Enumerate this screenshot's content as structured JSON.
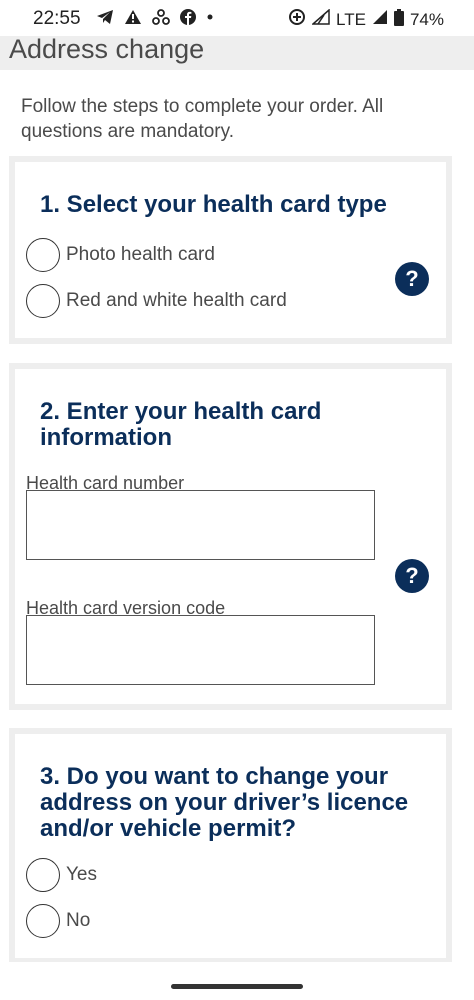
{
  "status_bar": {
    "time": "22:55",
    "network": "LTE",
    "battery": "74%",
    "icons_left": [
      "telegram-icon",
      "warning-icon",
      "recycle-icon",
      "facebook-icon",
      "dot-icon"
    ],
    "icons_right": [
      "data-saver-icon",
      "signal-icon",
      "battery-icon"
    ]
  },
  "header": {
    "title": "Address change"
  },
  "intro_text": "Follow the steps to complete your order. All questions are mandatory.",
  "section1": {
    "title": "1. Select your health card type",
    "options": [
      "Photo health card",
      "Red and white health card"
    ],
    "help_label": "?"
  },
  "section2": {
    "title": "2. Enter your health card information",
    "field1_label": "Health card number",
    "field1_value": "",
    "field2_label": "Health card version code",
    "field2_value": "",
    "help_label": "?"
  },
  "section3": {
    "title": "3. Do you want to change your address on your driver’s licence and/or vehicle permit?",
    "options": [
      "Yes",
      "No"
    ]
  },
  "colors": {
    "accent": "#0b2e5a",
    "card_border": "#eeeeee",
    "header_bg": "#eeeeee",
    "text": "#4a4a4a"
  }
}
